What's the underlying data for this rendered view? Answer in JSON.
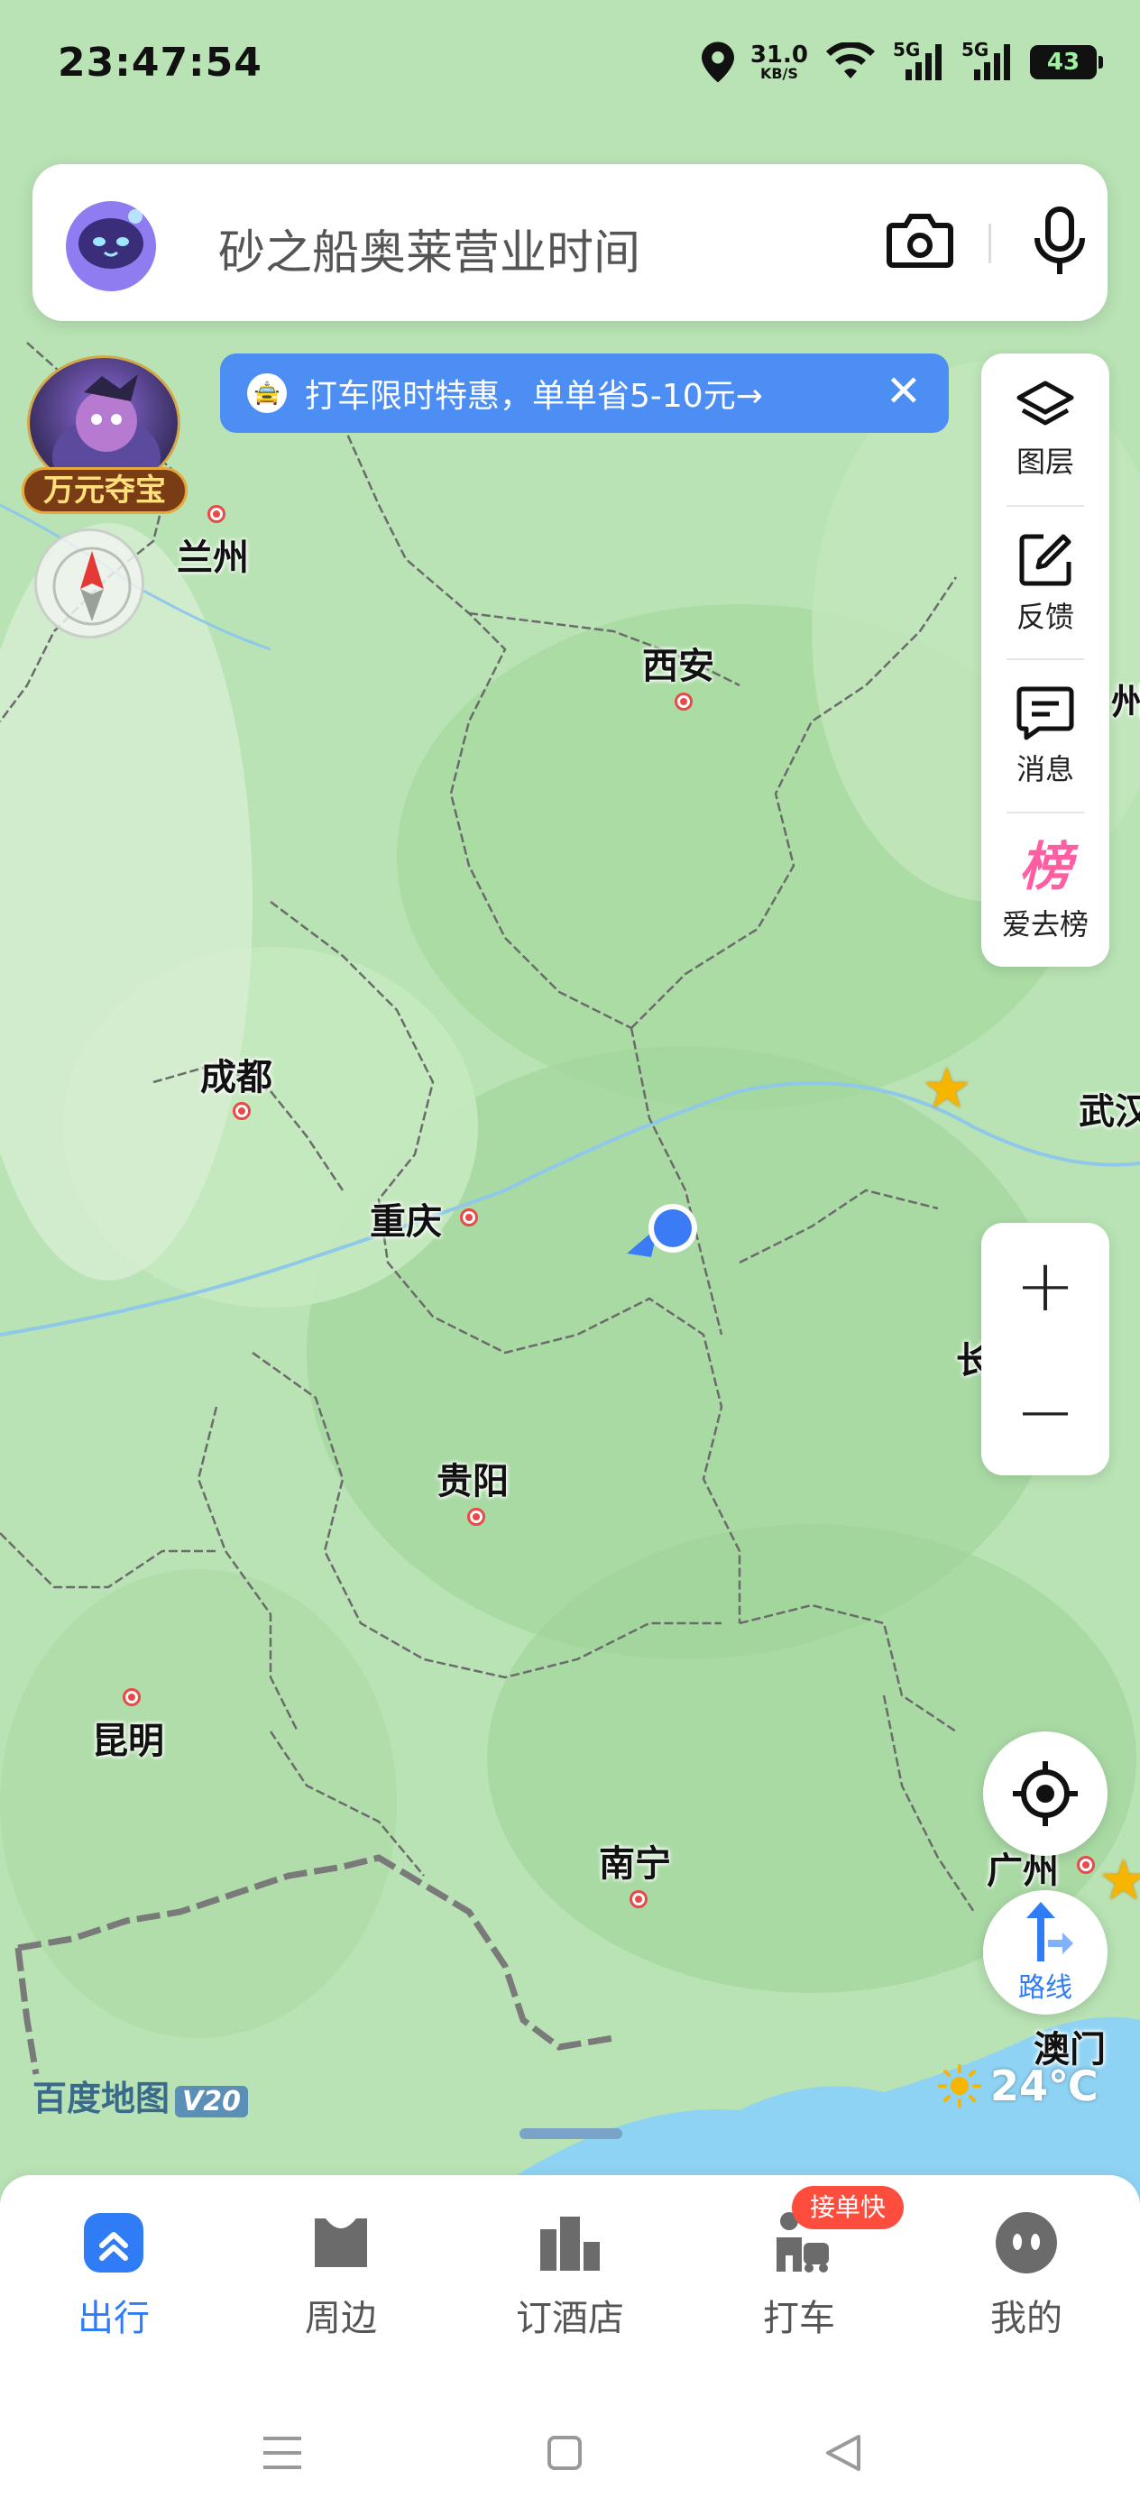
{
  "status_bar": {
    "time": "23:47:54",
    "net_speed_value": "31.0",
    "net_speed_unit": "KB/S",
    "signal_1": "5G",
    "signal_2": "5G",
    "battery": "43"
  },
  "search": {
    "placeholder": "砂之船奥莱营业时间",
    "icons": [
      "assistant-robot-icon",
      "camera-icon",
      "microphone-icon"
    ]
  },
  "promo_banner": {
    "text": "打车限时特惠，单单省5-10元→",
    "close": "✕"
  },
  "treasure": {
    "label": "万元夺宝"
  },
  "map_tools": [
    {
      "id": "layers",
      "label": "图层",
      "icon": "layers-icon"
    },
    {
      "id": "feedback",
      "label": "反馈",
      "icon": "edit-icon"
    },
    {
      "id": "messages",
      "label": "消息",
      "icon": "message-icon"
    },
    {
      "id": "ranking",
      "label": "爱去榜",
      "icon": "ranking-icon"
    }
  ],
  "zoom": {
    "in": "+",
    "out": "−"
  },
  "route": {
    "label": "路线"
  },
  "map": {
    "cities": [
      {
        "name": "兰州",
        "id": "lanzhou"
      },
      {
        "name": "西安",
        "id": "xian"
      },
      {
        "name": "成都",
        "id": "chengdu"
      },
      {
        "name": "重庆",
        "id": "chongqing"
      },
      {
        "name": "贵阳",
        "id": "guiyang"
      },
      {
        "name": "昆明",
        "id": "kunming"
      },
      {
        "name": "南宁",
        "id": "nanning"
      },
      {
        "name": "广州",
        "id": "guangzhou"
      },
      {
        "name": "澳门",
        "id": "macau"
      },
      {
        "name": "武汉",
        "id": "wuhan"
      },
      {
        "name": "长",
        "id": "changsha"
      },
      {
        "name": "州",
        "id": "zhengzhou"
      }
    ],
    "watermark": "百度地图",
    "watermark_badge": "V20"
  },
  "weather": {
    "temp": "24℃",
    "icon": "sun-icon"
  },
  "bottom_nav": [
    {
      "label": "出行",
      "icon": "travel-icon",
      "active": true
    },
    {
      "label": "周边",
      "icon": "nearby-icon",
      "active": false
    },
    {
      "label": "订酒店",
      "icon": "hotel-icon",
      "active": false
    },
    {
      "label": "打车",
      "icon": "taxi-icon",
      "active": false
    },
    {
      "label": "我的",
      "icon": "profile-icon",
      "active": false
    }
  ],
  "taxi_badge": "接单快",
  "colors": {
    "accent": "#2f7cf6",
    "banner": "#4d8ef4",
    "map_land": "#b9e3b4",
    "map_sea": "#8fd3f4",
    "badge_red": "#ff4d3d"
  }
}
